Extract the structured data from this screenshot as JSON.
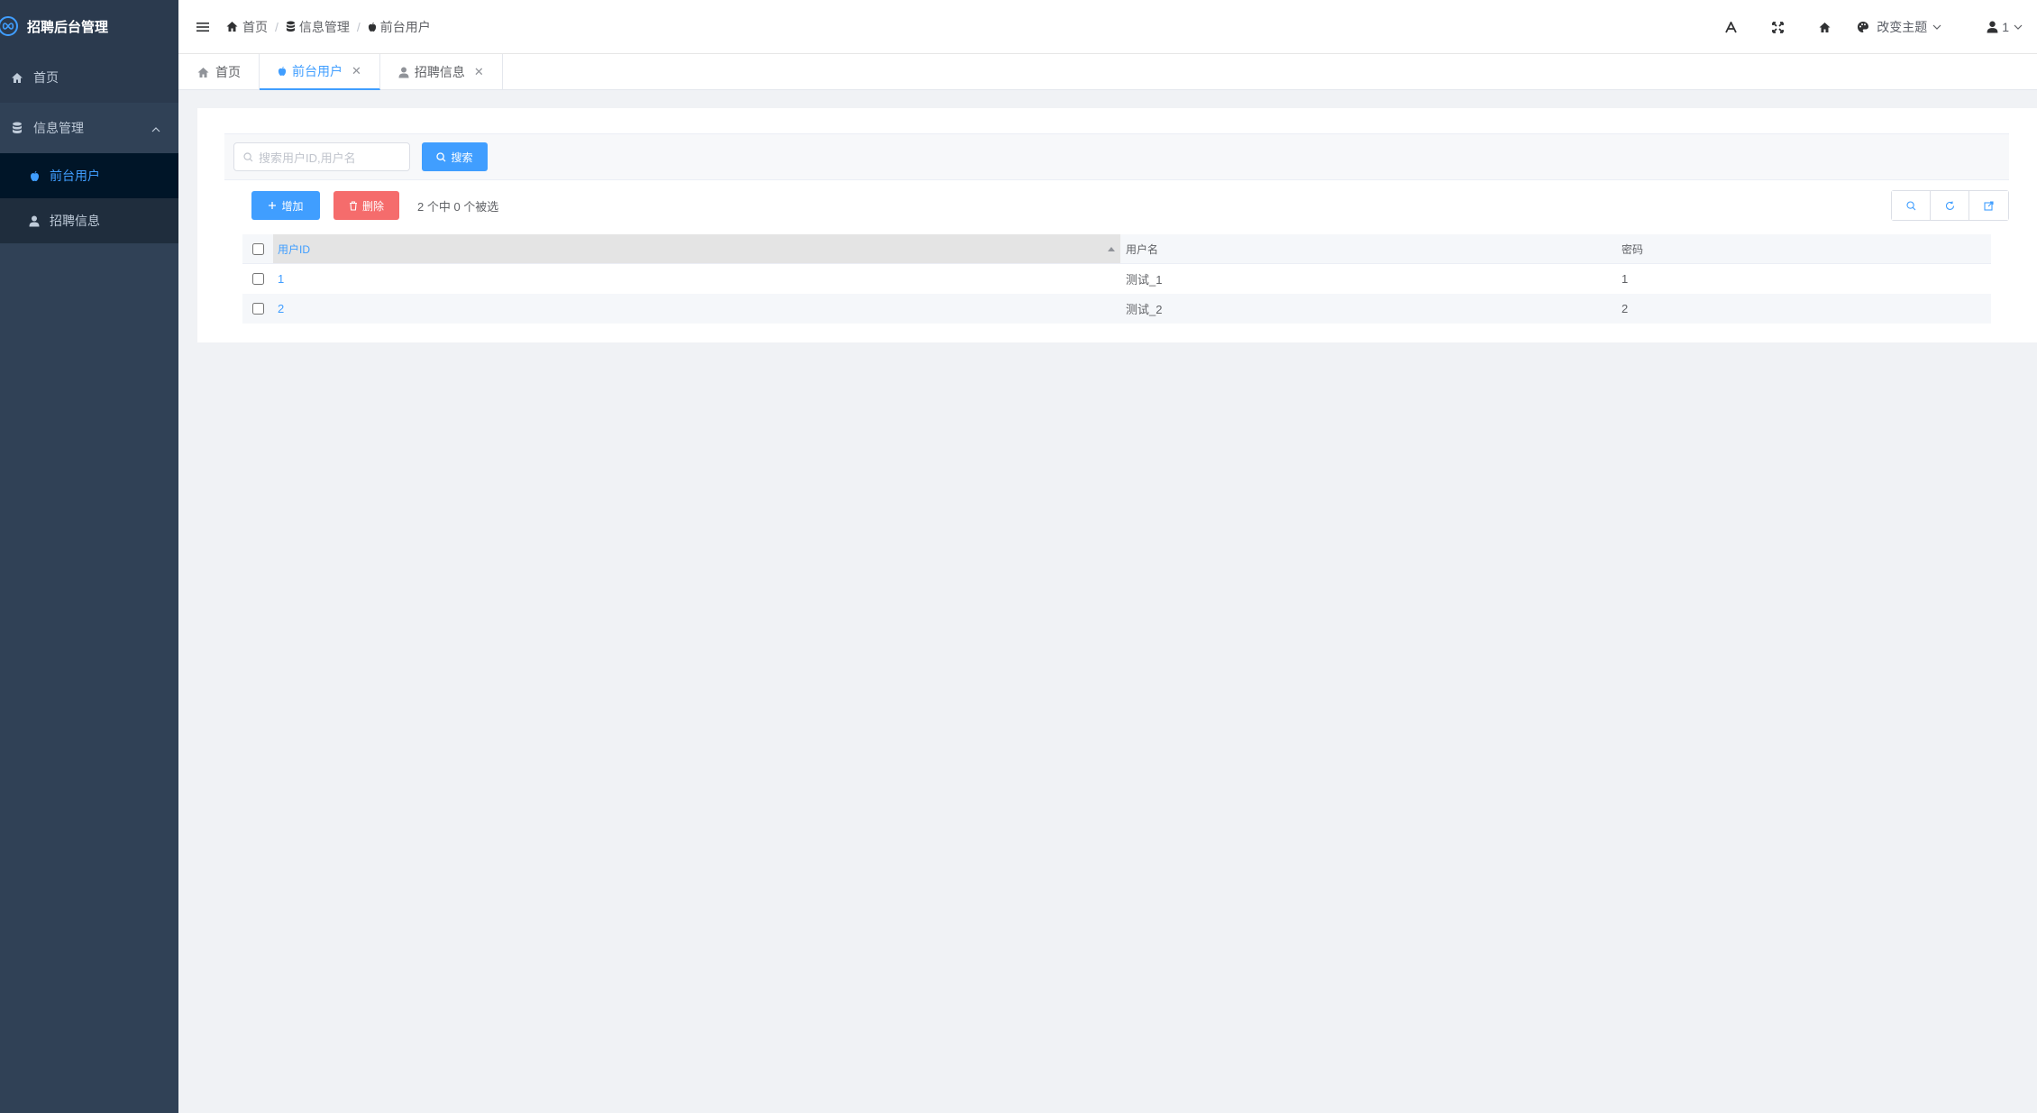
{
  "app": {
    "title": "招聘后台管理"
  },
  "sidebar": {
    "items": [
      {
        "label": "首页",
        "icon": "home-icon"
      },
      {
        "label": "信息管理",
        "icon": "database-icon",
        "children": [
          {
            "label": "前台用户",
            "icon": "apple-icon",
            "active": true
          },
          {
            "label": "招聘信息",
            "icon": "user-icon"
          }
        ]
      }
    ]
  },
  "breadcrumb": [
    {
      "label": "首页",
      "icon": "home-icon"
    },
    {
      "label": "信息管理",
      "icon": "database-icon"
    },
    {
      "label": "前台用户",
      "icon": "apple-icon"
    }
  ],
  "header": {
    "theme_label": "改变主题",
    "user_label": "1"
  },
  "tabs": [
    {
      "label": "首页",
      "icon": "home-icon",
      "closable": false
    },
    {
      "label": "前台用户",
      "icon": "apple-icon",
      "closable": true,
      "active": true
    },
    {
      "label": "招聘信息",
      "icon": "user-icon",
      "closable": true
    }
  ],
  "search": {
    "placeholder": "搜索用户ID,用户名",
    "button_label": "搜索"
  },
  "toolbar": {
    "add_label": "增加",
    "delete_label": "删除",
    "selection_info": "2 个中 0 个被选"
  },
  "table": {
    "columns": [
      "用户ID",
      "用户名",
      "密码"
    ],
    "rows": [
      {
        "id": "1",
        "username": "测试_1",
        "password": "1"
      },
      {
        "id": "2",
        "username": "测试_2",
        "password": "2"
      }
    ]
  },
  "colors": {
    "accent": "#409eff",
    "danger": "#f56c6c",
    "sidebar_bg": "#304156",
    "sidebar_active_bg": "#001528"
  }
}
